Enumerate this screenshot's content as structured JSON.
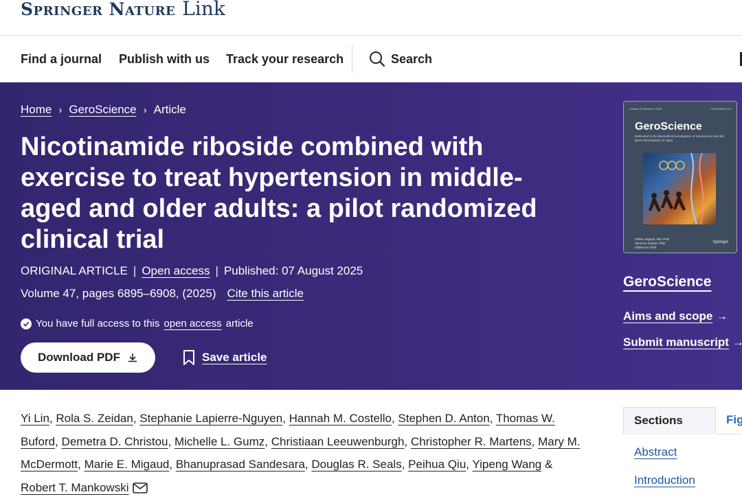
{
  "brand": {
    "name": "Springer Nature",
    "link_word": "Link"
  },
  "nav": {
    "find_journal": "Find a journal",
    "publish": "Publish with us",
    "track": "Track your research",
    "search": "Search"
  },
  "breadcrumb": {
    "home": "Home",
    "journal": "GeroScience",
    "current": "Article",
    "separator": "›"
  },
  "article": {
    "title": "Nicotinamide riboside combined with exercise to treat hypertension in middle-aged and older adults: a pilot randomized clinical trial",
    "type": "ORIGINAL ARTICLE",
    "open_access": "Open access",
    "published": "Published: 07 August 2025",
    "volume": "Volume 47, pages 6895–6908, (2025)",
    "cite": "Cite this article",
    "access_prefix": "You have full access to this",
    "access_link": "open access",
    "access_suffix": "article",
    "download": "Download PDF",
    "save": "Save article"
  },
  "cover": {
    "title": "GeroScience",
    "top_left": "Volume 47 Number 5 2025",
    "top_right": "ISSN 2509-2715",
    "subtitle": "Dedicated to the Biomedical Investigation of Senescence and the Basic Mechanisms of Aging",
    "editor1": "Zoltan Ungvari, MD, PhD",
    "editor2": "Veronica Galvan, PhD",
    "editor_role": "Editors-in-Chief",
    "publisher": "Springer"
  },
  "sidebar": {
    "journal": "GeroScience",
    "aims": "Aims and scope",
    "submit": "Submit manuscript"
  },
  "authors": [
    "Yi Lin",
    "Rola S. Zeidan",
    "Stephanie Lapierre-Nguyen",
    "Hannah M. Costello",
    "Stephen D. Anton",
    "Thomas W. Buford",
    "Demetra D. Christou",
    "Michelle L. Gumz",
    "Christiaan Leeuwenburgh",
    "Christopher R. Martens",
    "Mary M. McDermott",
    "Marie E. Migaud",
    "Bhanuprasad Sandesara",
    "Douglas R. Seals",
    "Peihua Qiu",
    "Yipeng Wang",
    "Robert T. Mankowski"
  ],
  "authors_joiner": "&",
  "tabs": {
    "sections": "Sections",
    "figures": "Fig"
  },
  "section_links": {
    "abstract": "Abstract",
    "introduction": "Introduction"
  },
  "colors": {
    "hero": "#3b2a7a",
    "brand": "#1f3a5a",
    "link": "#1c56a5"
  },
  "icons": {
    "search": "search-icon",
    "download": "download-icon",
    "bookmark": "bookmark-icon",
    "check": "check-circle-icon",
    "mail": "mail-icon",
    "arrow": "arrow-right-icon"
  }
}
